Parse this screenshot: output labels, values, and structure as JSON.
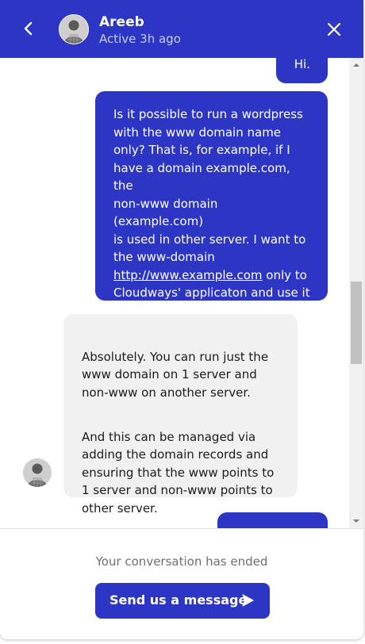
{
  "header": {
    "agent_name": "Areeb",
    "agent_status": "Active 3h ago",
    "back_icon": "chevron-left-icon",
    "close_icon": "close-icon"
  },
  "messages": [
    {
      "sender": "user",
      "text": "Hi."
    },
    {
      "sender": "user",
      "text_before_link": "Is it possible to run a wordpress\nwith the www domain name\nonly? That is, for example, if I\nhave a domain example.com, the\nnon-www domain (example.com)\nis used in other server. I want to\nthe www-domain\n",
      "link": "http://www.example.com",
      "text_after_link": " only to\nCloudways' applicaton and use it\non a WordPress site."
    },
    {
      "sender": "agent",
      "paragraphs": [
        "Absolutely. You can run just the\nwww domain on 1 server and\nnon-www on another server.",
        "And this can be managed via\nadding the domain records and\nensuring that the www points to\n1 server and non-www points to\nother server."
      ]
    },
    {
      "sender": "user",
      "text": ""
    }
  ],
  "footer": {
    "ended_text": "Your conversation has ended",
    "send_label": "Send us a message",
    "send_icon": "send-arrow-icon"
  },
  "colors": {
    "brand": "#2d35c4",
    "agent_bubble": "#f1f1f1",
    "muted_text": "#6e6e6e"
  }
}
